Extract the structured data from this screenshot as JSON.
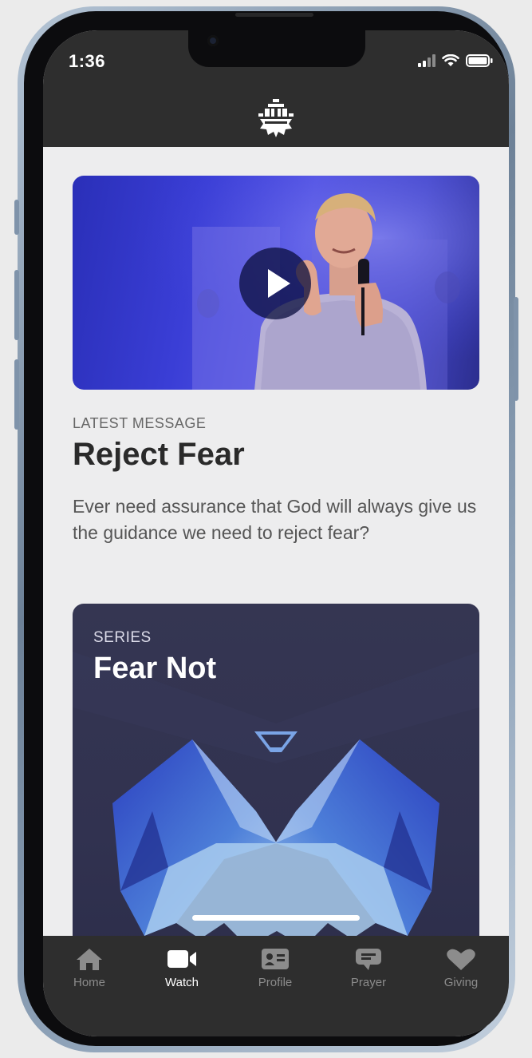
{
  "status_bar": {
    "time": "1:36"
  },
  "colors": {
    "bar_bg": "#2e2e2e",
    "content_bg": "#ededee",
    "active_tab": "#ffffff",
    "inactive_tab": "#8c8c8c"
  },
  "latest_message": {
    "eyebrow": "LATEST MESSAGE",
    "title": "Reject Fear",
    "description": "Ever need assurance that God will always give us the guidance we need to reject fear?"
  },
  "series": {
    "eyebrow": "SERIES",
    "title": "Fear Not"
  },
  "tabs": [
    {
      "label": "Home",
      "icon": "home-icon",
      "active": false
    },
    {
      "label": "Watch",
      "icon": "video-camera-icon",
      "active": true
    },
    {
      "label": "Profile",
      "icon": "id-card-icon",
      "active": false
    },
    {
      "label": "Prayer",
      "icon": "chat-bubble-icon",
      "active": false
    },
    {
      "label": "Giving",
      "icon": "heart-icon",
      "active": false
    }
  ]
}
